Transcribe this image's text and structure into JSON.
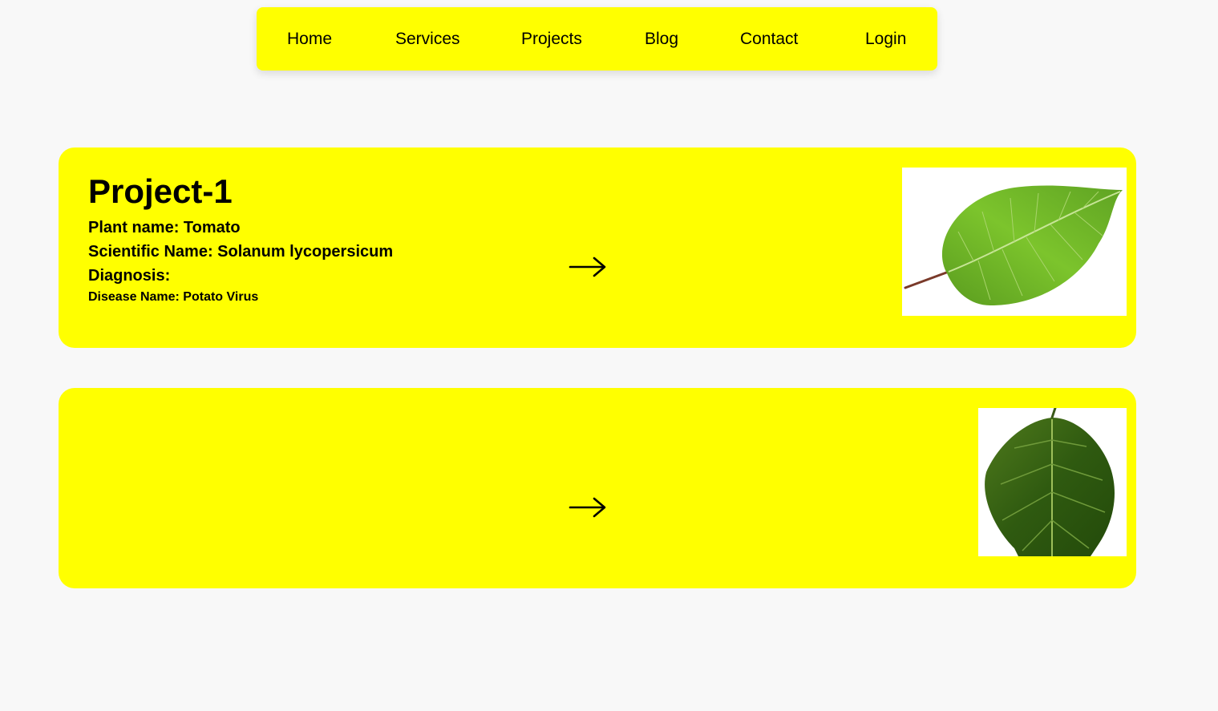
{
  "nav": {
    "items": [
      {
        "label": "Home"
      },
      {
        "label": "Services"
      },
      {
        "label": "Projects"
      },
      {
        "label": "Blog"
      },
      {
        "label": "Contact"
      },
      {
        "label": "Login"
      }
    ]
  },
  "colors": {
    "accent": "#ffff00",
    "background": "#f8f8f8",
    "text": "#000000"
  },
  "projects": [
    {
      "title": "Project-1",
      "plant_name": "Plant name: Tomato",
      "scientific_name": "Scientific Name: Solanum lycopersicum",
      "diagnosis": "Diagnosis:",
      "disease_name": "Disease Name: Potato Virus",
      "arrow_icon": "right-arrow-icon",
      "image": "light-green-leaf-image"
    },
    {
      "arrow_icon": "right-arrow-icon",
      "image": "dark-green-leaf-image"
    }
  ]
}
